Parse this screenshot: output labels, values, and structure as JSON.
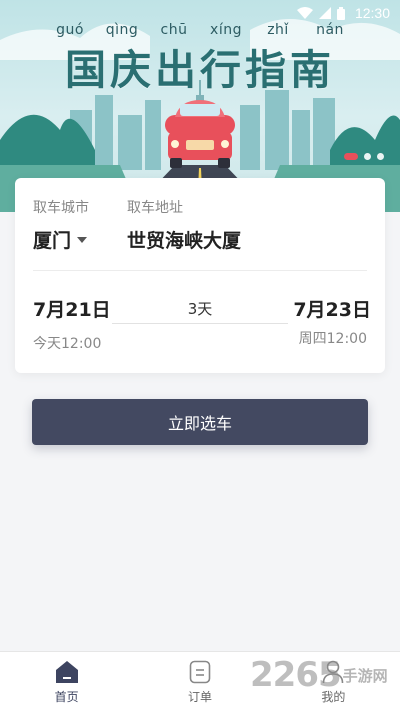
{
  "status_bar": {
    "time": "12:30",
    "icons": [
      "wifi-icon",
      "signal-icon",
      "battery-icon"
    ]
  },
  "banner": {
    "pinyin": [
      "guó",
      "qìng",
      "chū",
      "xíng",
      "zhǐ",
      "nán"
    ],
    "title": "国庆出行指南",
    "dots_count": 3,
    "active_dot": 0
  },
  "booking": {
    "city_label": "取车城市",
    "address_label": "取车地址",
    "city": "厦门",
    "address": "世贸海峡大厦",
    "pickup_date": "7月21日",
    "pickup_time": "今天12:00",
    "duration": "3天",
    "return_date": "7月23日",
    "return_time": "周四12:00"
  },
  "select_button": {
    "label": "立即选车"
  },
  "nav": {
    "items": [
      {
        "label": "首页",
        "icon": "home-icon",
        "active": true
      },
      {
        "label": "订单",
        "icon": "order-icon",
        "active": false
      },
      {
        "label": "我的",
        "icon": "profile-icon",
        "active": false
      }
    ]
  },
  "watermark": {
    "number": "2265",
    "text": "手游网",
    "url": ""
  },
  "colors": {
    "accent": "#434961",
    "banner_title": "#2a6f72",
    "car_red": "#e8505b",
    "background": "#f4f5f7"
  }
}
